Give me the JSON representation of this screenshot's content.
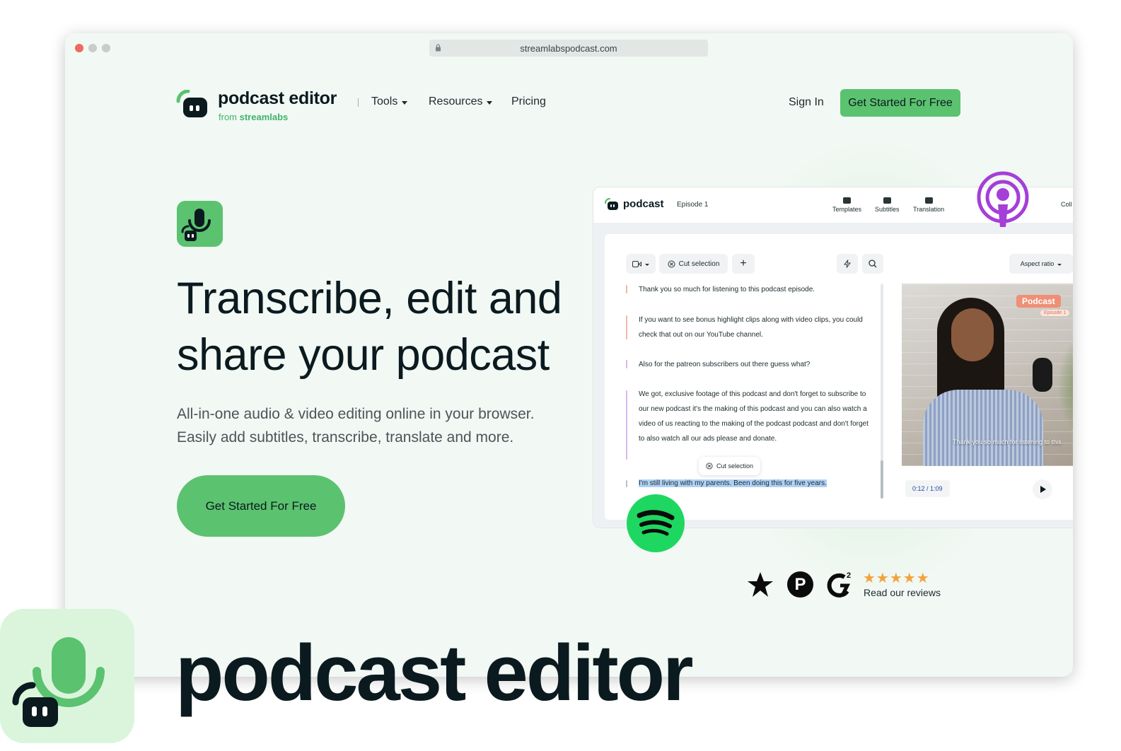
{
  "browser": {
    "url": "streamlabspodcast.com",
    "traffic_colors": [
      "#ed6a5e",
      "#c9cccb",
      "#c9cccb"
    ]
  },
  "nav": {
    "logo_title": "podcast editor",
    "logo_sub_prefix": "from",
    "logo_sub_brand": "streamlabs",
    "items": [
      {
        "label": "Tools",
        "has_dropdown": true
      },
      {
        "label": "Resources",
        "has_dropdown": true
      },
      {
        "label": "Pricing",
        "has_dropdown": false
      }
    ],
    "signin": "Sign In",
    "cta": "Get Started For Free"
  },
  "hero": {
    "title_line1": "Transcribe, edit and",
    "title_line2": "share your podcast",
    "subtitle_line1": "All-in-one audio & video editing online in your browser.",
    "subtitle_line2": "Easily add subtitles, transcribe, translate and more.",
    "cta": "Get Started For Free"
  },
  "app": {
    "name": "podcast",
    "episode": "Episode 1",
    "tools": [
      "Templates",
      "Subtitles",
      "Translation"
    ],
    "tool_cut": "Coll",
    "toolbar": {
      "cut_selection": "Cut selection",
      "aspect_ratio": "Aspect ratio"
    },
    "transcript": [
      "Thank you so much for listening to this podcast episode.",
      "If you want to see bonus highlight clips along with video clips, you could check that out on our YouTube channel.",
      "Also for the patreon subscribers out there guess what?",
      "We got, exclusive footage of this podcast and don't forget to subscribe to our new podcast it's the making of this podcast and you can also watch a video of us reacting to the making of the podcast podcast and don't forget to also watch all our ads please and donate.",
      "I'm still living with my parents. Been doing this for five years."
    ],
    "cut_popup": "Cut selection",
    "video": {
      "tag": "Podcast",
      "tag_sub": "Episode 1",
      "caption": "Thank you so much for listening to this",
      "time": "0:12 / 1:09"
    }
  },
  "reviews": {
    "stars": "★★★★★",
    "text": "Read our reviews",
    "p_badge": "P"
  },
  "branding": {
    "wordmark": "podcast editor"
  },
  "colors": {
    "green": "#5bc26f",
    "apple_podcasts": "#a43fd8",
    "spotify": "#1ed760",
    "star": "#f3a23b"
  }
}
